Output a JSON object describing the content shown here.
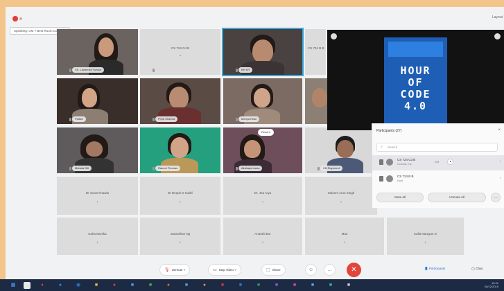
{
  "app": {
    "speaking_text": "Speaking: CM 7 Best Room Control 4",
    "layout_label": "Layout"
  },
  "grid": {
    "video_tiles": [
      {
        "name": "SS. Lawrence School"
      },
      {
        "name": "BH KR"
      },
      {
        "name": "Pallavi"
      },
      {
        "name": "Priya Sharma"
      },
      {
        "name": "Mariya Kiran"
      },
      {
        "name": "Mridula Gill"
      },
      {
        "name": "Raboni Thomas"
      },
      {
        "name": "Akshaya Lama"
      },
      {
        "name": "CB Raymond"
      }
    ],
    "name_tiles": [
      {
        "name": "CS 724 Cd B"
      },
      {
        "name": "CS 724 B B"
      },
      {
        "name": "Shi"
      },
      {
        "name": "Dr Surat Chawla"
      },
      {
        "name": "Dr Deepti S Sodhi"
      },
      {
        "name": "Dr. Jha Arya"
      },
      {
        "name": "Saleem Arun Singh"
      },
      {
        "name": "Kalra Monika"
      },
      {
        "name": "Janardhan Ng"
      },
      {
        "name": "Ananthi Bor"
      },
      {
        "name": "Man"
      },
      {
        "name": "Kalla Narayan D"
      }
    ],
    "recent_label": "Recent"
  },
  "share": {
    "poster_title_lines": [
      "HOUR",
      "OF",
      "CODE",
      "4.0"
    ]
  },
  "participants": {
    "header": "Participants (27)",
    "search_placeholder": "Search",
    "rows": [
      {
        "name": "CS 724 Cd B",
        "role": "Co-host, me",
        "tag": "CH"
      },
      {
        "name": "CS 724 B B",
        "role": "Host",
        "tag": ""
      }
    ],
    "mute_all_label": "Mute all",
    "unmute_all_label": "Unmute all"
  },
  "controls": {
    "unmute_label": "Unmute",
    "stop_video_label": "Stop video",
    "share_label": "Share",
    "participants_label": "Participants",
    "chat_label": "Chat"
  },
  "taskbar": {
    "time": "10:41",
    "date": "05/12/2019"
  },
  "colors": {
    "accent": "#3aa7d9",
    "end_call": "#e0463a",
    "poster_blue": "#1e5fb5",
    "taskbar": "#1d2a44"
  },
  "icons": [
    "mic-icon",
    "video-icon",
    "share-icon",
    "emoji-icon",
    "more-icon",
    "end-call-icon",
    "participants-icon",
    "chat-icon",
    "search-icon",
    "close-icon"
  ]
}
